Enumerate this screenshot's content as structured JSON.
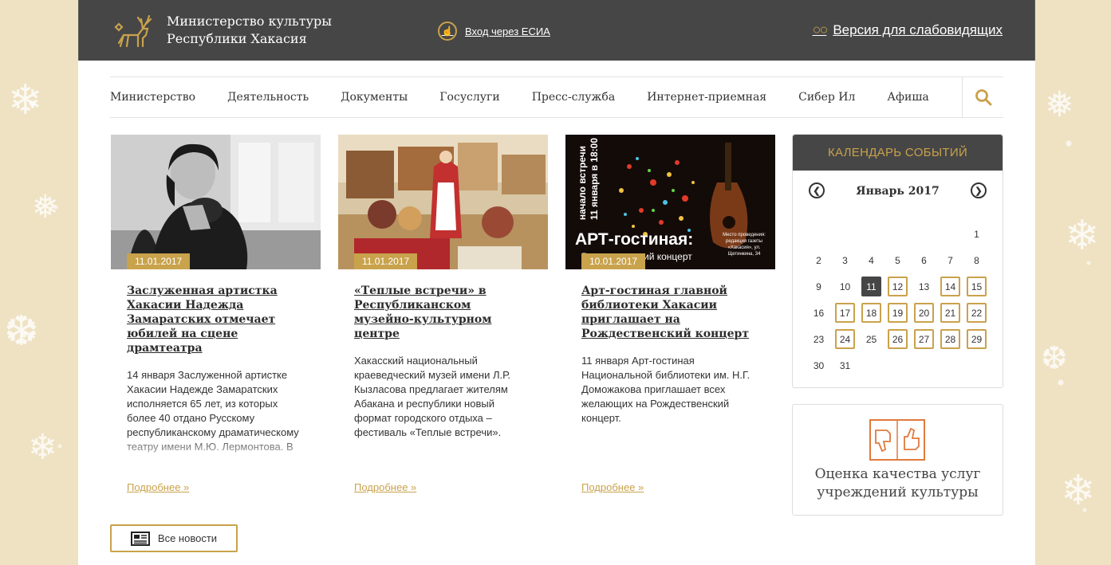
{
  "header": {
    "org_line1": "Министерство культуры",
    "org_line2": "Республики Хакасия",
    "esia_label": "Вход через ЕСИА",
    "vision_label": "Версия для слабовидящих"
  },
  "nav": {
    "items": [
      "Министерство",
      "Деятельность",
      "Документы",
      "Госуслуги",
      "Пресс-служба",
      "Интернет-приемная",
      "Сибер Ил",
      "Афиша"
    ]
  },
  "news": [
    {
      "date": "11.01.2017",
      "title": "Заслуженная артистка Хакасии Надежда Замаратских отмечает юбилей на сцене драмтеатра",
      "text": "14 января Заслуженной артистке Хакасии Надежде Замаратских исполняется 65 лет, из которых более 40 отдано Русскому республиканскому драматическому театру имени М.Ю. Лермонтова. В",
      "more": "Подробнее »"
    },
    {
      "date": "11.01.2017",
      "title": "«Теплые встречи» в Республиканском музейно-культурном центре",
      "text": "Хакасский национальный краеведческий музей имени Л.Р. Кызласова предлагает жителям Абакана и республики новый формат городского отдыха – фестиваль «Теплые встречи».",
      "more": "Подробнее »"
    },
    {
      "date": "10.01.2017",
      "title": "Арт-гостиная главной библиотеки Хакасии приглашает на Рождественский концерт",
      "text": "11 января Арт-гостиная Национальной библиотеки им. Н.Г. Доможакова приглашает всех желающих на Рождественский концерт.",
      "more": "Подробнее »",
      "poster": {
        "vertical_line1": "начало встречи",
        "vertical_line2": "11 января в 18:00",
        "headline": "АРТ-гостиная:",
        "subline": "Рождественский концерт",
        "venue": "Место проведения: редакция газеты «Хакасия», ул. Щетинкина, 34"
      }
    }
  ],
  "all_news_label": "Все новости",
  "calendar": {
    "heading": "КАЛЕНДАРЬ СОБЫТИЙ",
    "month": "Январь 2017",
    "today": 11,
    "event_days": [
      12,
      14,
      15,
      17,
      18,
      19,
      20,
      21,
      22,
      24,
      26,
      27,
      28,
      29
    ],
    "leading_blanks": 6,
    "days_in_month": 31
  },
  "rating": {
    "line1": "Оценка качества услуг",
    "line2": "учреждений культуры"
  },
  "colors": {
    "accent": "#c9a24c",
    "dark": "#464646"
  }
}
